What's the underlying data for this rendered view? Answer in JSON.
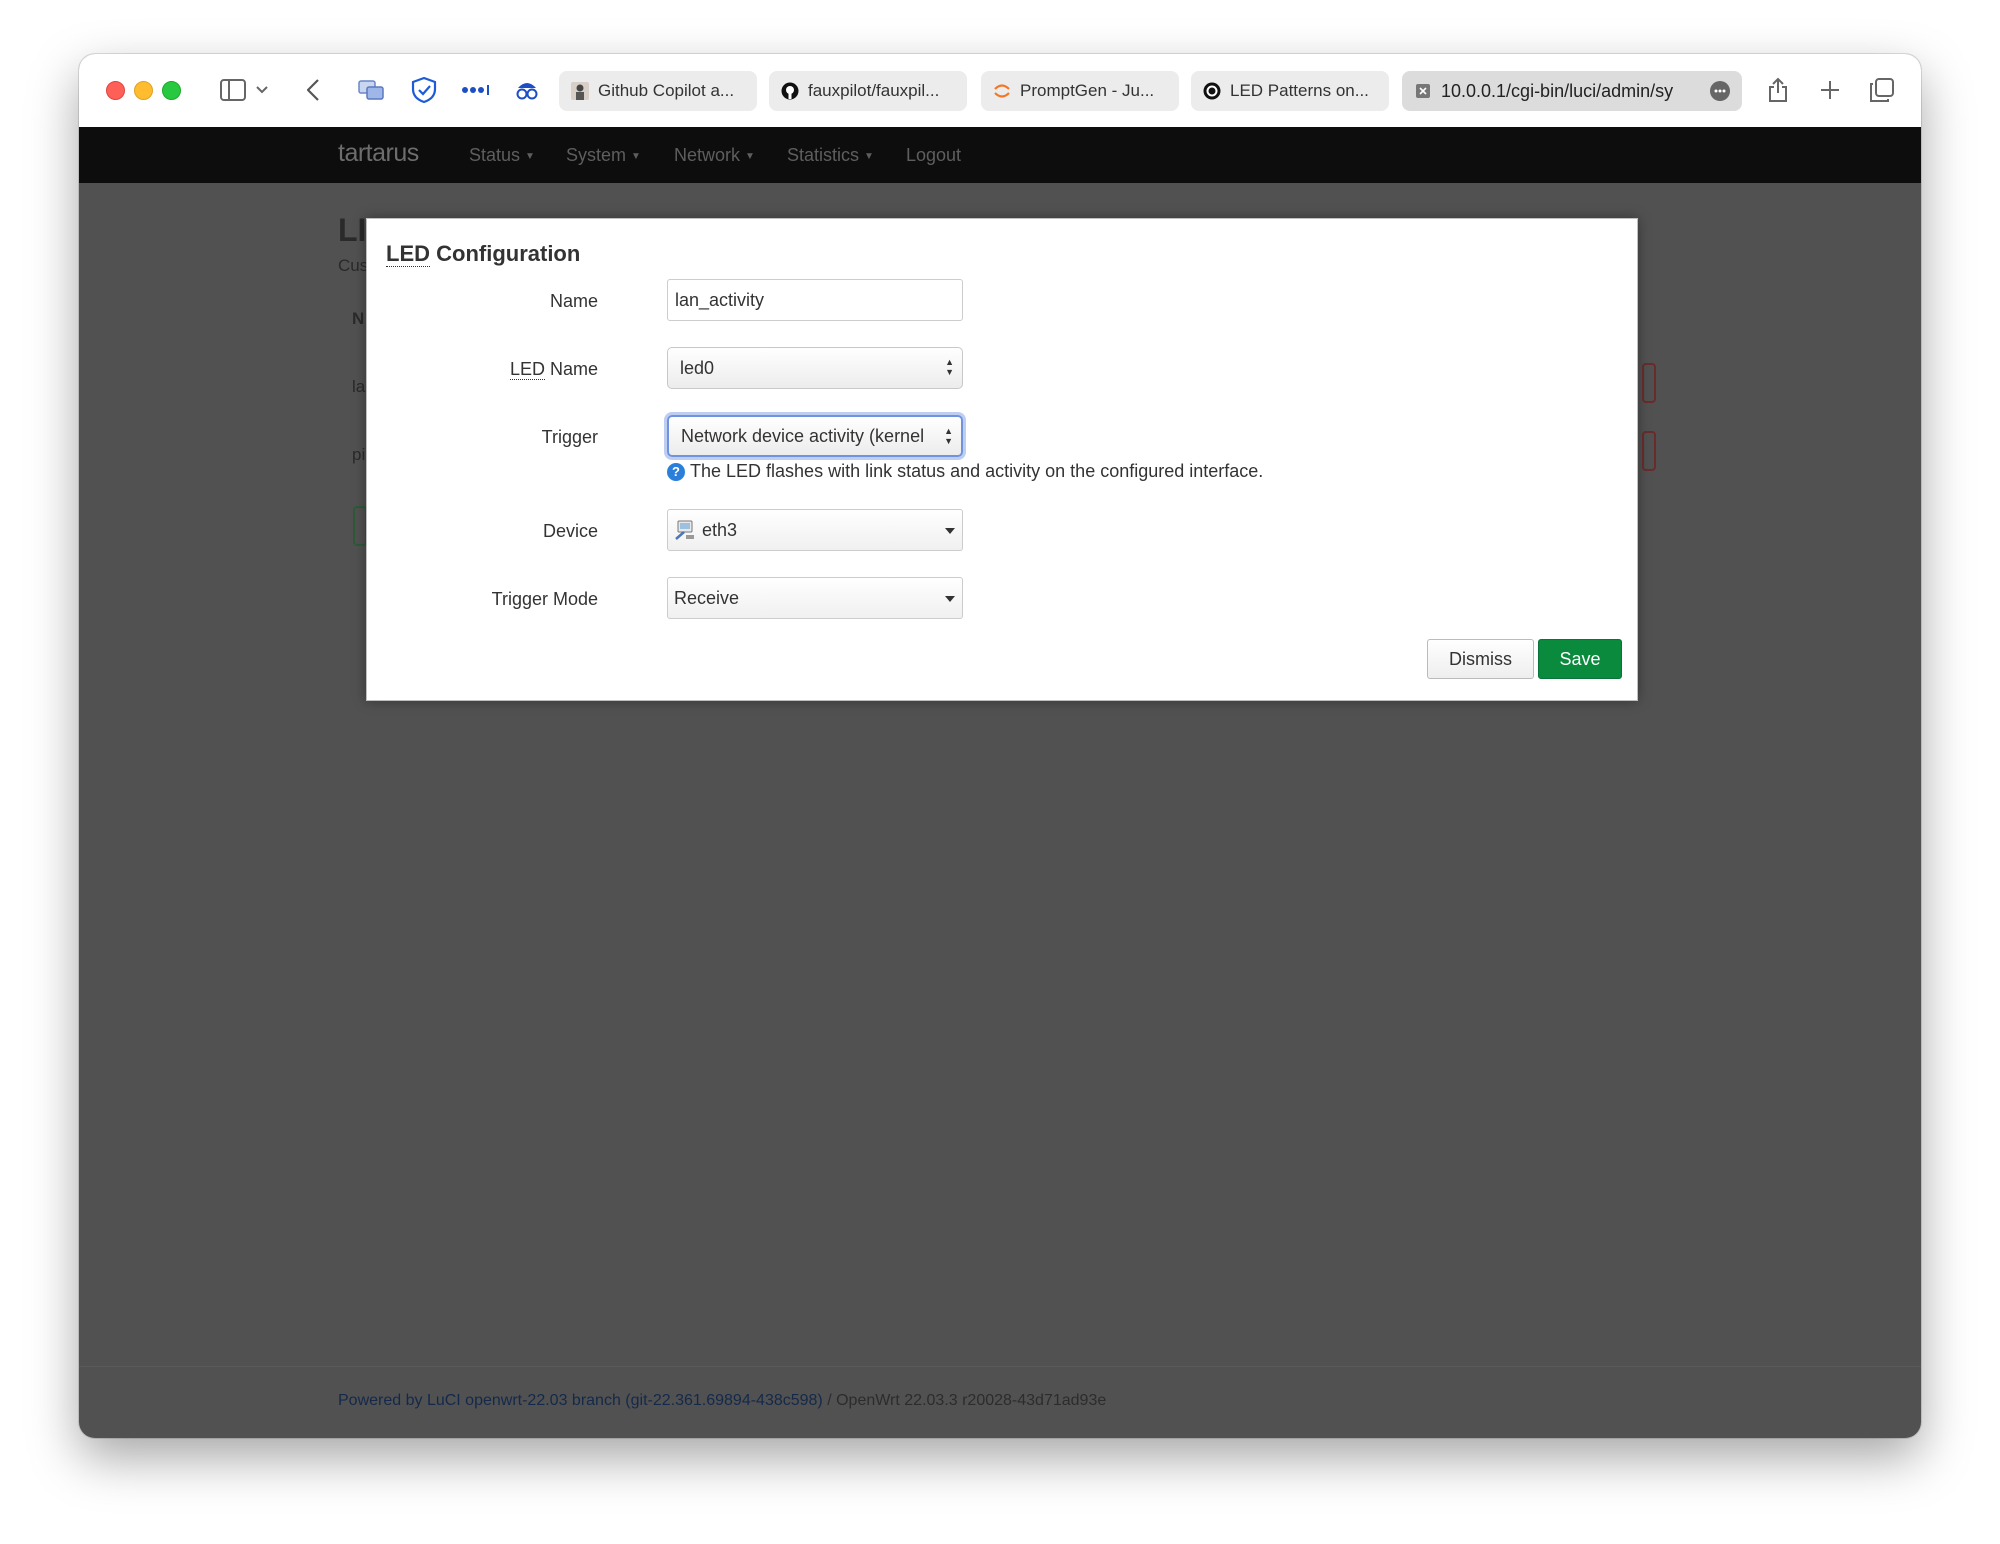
{
  "browser": {
    "tabs": [
      {
        "label": "Github Copilot a...",
        "icon": "avatar-icon"
      },
      {
        "label": "fauxpilot/fauxpil...",
        "icon": "github-icon"
      },
      {
        "label": "PromptGen - Ju...",
        "icon": "jupyter-icon"
      },
      {
        "label": "LED Patterns on...",
        "icon": "openai-icon"
      }
    ],
    "active_tab": {
      "label": "10.0.0.1/cgi-bin/luci/admin/sy",
      "icon": "close-tab-icon"
    }
  },
  "navbar": {
    "brand": "tartarus",
    "menu": [
      "Status",
      "System",
      "Network",
      "Statistics"
    ],
    "logout": "Logout"
  },
  "background": {
    "heading_frag": "LI",
    "sub_frag": "Cus",
    "col_frag": "N",
    "row1_frag": "la",
    "row2_frag": "pi"
  },
  "modal": {
    "title_abbr": "LED",
    "title_rest": " Configuration",
    "fields": {
      "name": {
        "label": "Name",
        "value": "lan_activity"
      },
      "led_name": {
        "label_abbr": "LED",
        "label_rest": " Name",
        "value": "led0"
      },
      "trigger": {
        "label": "Trigger",
        "value": "Network device activity (kernel",
        "help": "The LED flashes with link status and activity on the configured interface."
      },
      "device": {
        "label": "Device",
        "value": "eth3"
      },
      "trigger_mode": {
        "label": "Trigger Mode",
        "value": "Receive"
      }
    },
    "dismiss": "Dismiss",
    "save": "Save"
  },
  "footer": {
    "link": "Powered by LuCI openwrt-22.03 branch (git-22.361.69894-438c598)",
    "version": " / OpenWrt 22.03.3 r20028-43d71ad93e"
  }
}
